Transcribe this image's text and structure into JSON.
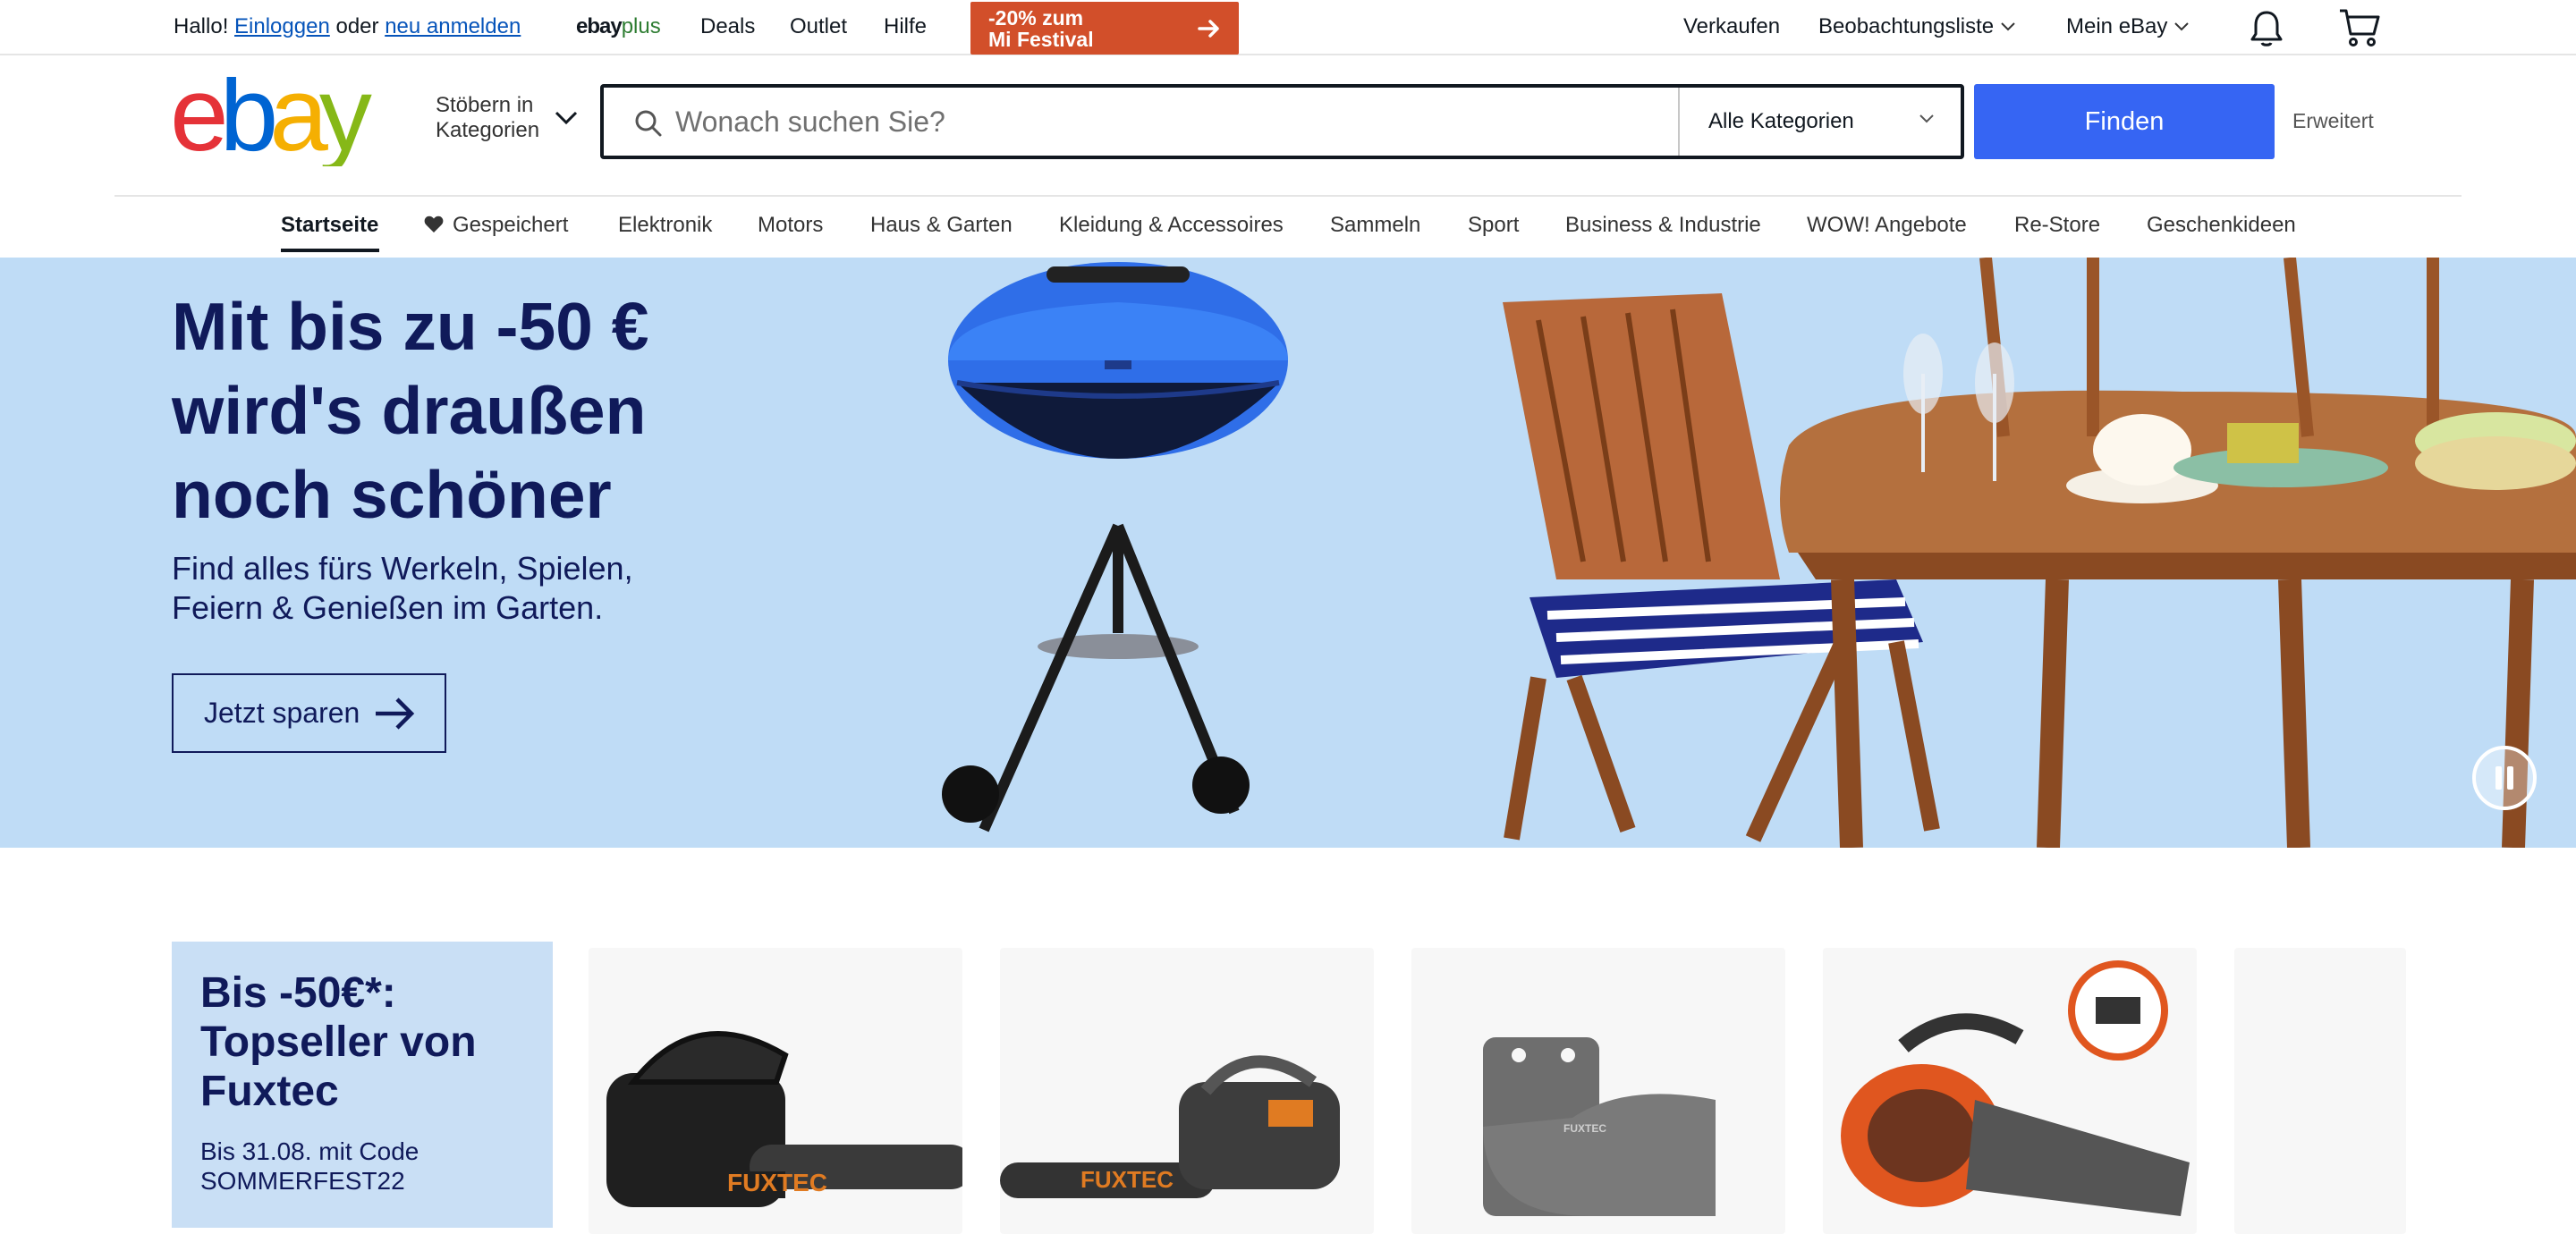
{
  "topbar": {
    "greeting_prefix": "Hallo!",
    "signin_label": "Einloggen",
    "greeting_mid": "oder",
    "register_label": "neu anmelden",
    "ebayplus_main": "ebay",
    "ebayplus_suffix": "plus",
    "deals_label": "Deals",
    "outlet_label": "Outlet",
    "help_label": "Hilfe",
    "promo_line1": "-20% zum",
    "promo_line2": "Mi Festival",
    "sell_label": "Verkaufen",
    "watchlist_label": "Beobachtungsliste",
    "my_ebay_label": "Mein eBay"
  },
  "header": {
    "browse_line1": "Stöbern in",
    "browse_line2": "Kategorien",
    "search_placeholder": "Wonach suchen Sie?",
    "category_selected": "Alle Kategorien",
    "find_label": "Finden",
    "advanced_label": "Erweitert"
  },
  "nav": {
    "tabs": [
      {
        "label": "Startseite"
      },
      {
        "label": "Gespeichert"
      },
      {
        "label": "Elektronik"
      },
      {
        "label": "Motors"
      },
      {
        "label": "Haus & Garten"
      },
      {
        "label": "Kleidung & Accessoires"
      },
      {
        "label": "Sammeln"
      },
      {
        "label": "Sport"
      },
      {
        "label": "Business & Industrie"
      },
      {
        "label": "WOW! Angebote"
      },
      {
        "label": "Re-Store"
      },
      {
        "label": "Geschenkideen"
      }
    ]
  },
  "hero": {
    "title_line1": "Mit bis zu -50 €",
    "title_line2": "wird's draußen",
    "title_line3": "noch schöner",
    "subtitle_line1": "Find alles fürs Werkeln, Spielen,",
    "subtitle_line2": "Feiern & Genießen im Garten.",
    "cta_label": "Jetzt sparen"
  },
  "promo": {
    "title_line1": "Bis -50€*:",
    "title_line2": "Topseller von",
    "title_line3": "Fuxtec",
    "subtitle_line1": "Bis 31.08. mit Code",
    "subtitle_line2": "SOMMERFEST22"
  },
  "products": {
    "brand_text": "FUXTEC"
  },
  "colors": {
    "accent_blue": "#3665f3",
    "link_blue": "#0654ba",
    "hero_bg": "#bfdcf6",
    "hero_text": "#101a5a",
    "promo_orange": "#d24f2a"
  }
}
